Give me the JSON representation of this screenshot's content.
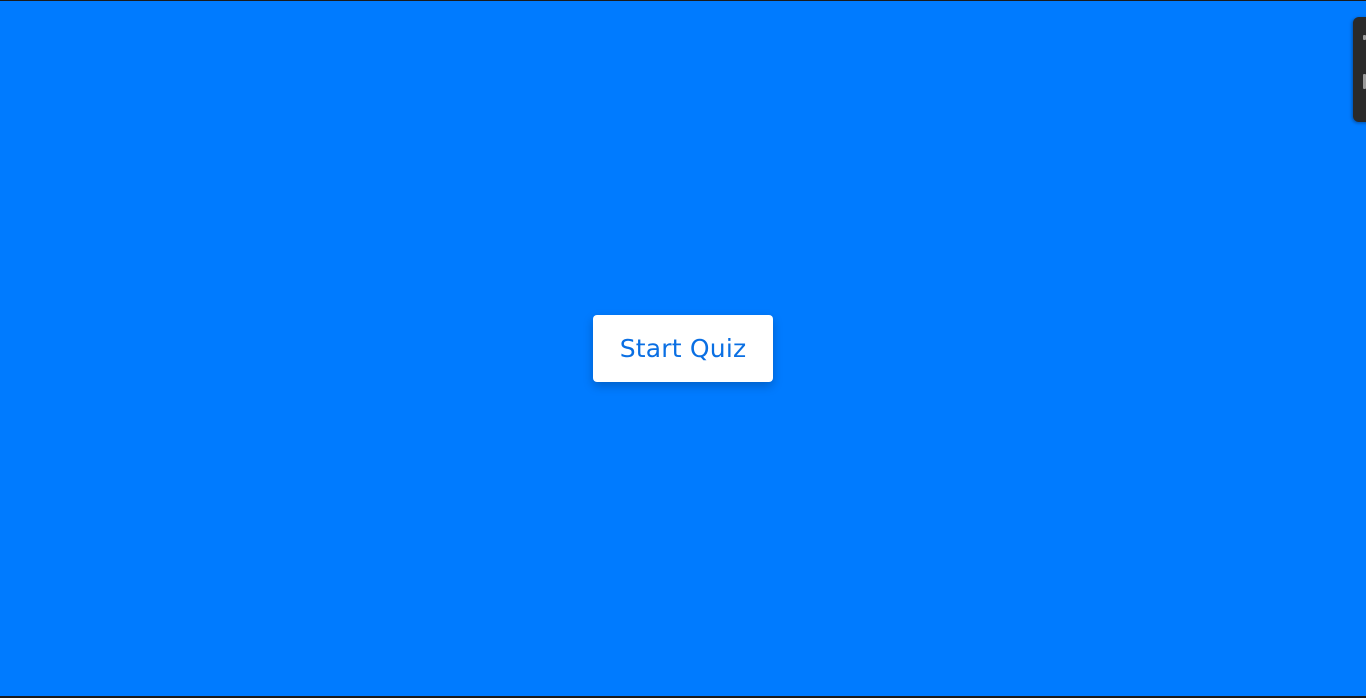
{
  "quiz": {
    "start_button_label": "Start Quiz"
  },
  "colors": {
    "background": "#007bff",
    "button_background": "#ffffff",
    "button_text": "#0a6fe3",
    "side_panel": "#2a2a2a"
  }
}
